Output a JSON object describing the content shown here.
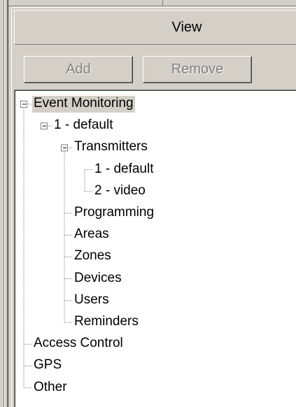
{
  "header": {
    "title": "View"
  },
  "toolbar": {
    "add_label": "Add",
    "remove_label": "Remove"
  },
  "tree": {
    "items": [
      {
        "label": "Event Monitoring",
        "level": 0,
        "expanded": true,
        "selected": true
      },
      {
        "label": "1 - default",
        "level": 1,
        "expanded": true
      },
      {
        "label": "Transmitters",
        "level": 2,
        "expanded": true
      },
      {
        "label": "1 - default",
        "level": 3
      },
      {
        "label": "2 - video",
        "level": 3
      },
      {
        "label": "Programming",
        "level": 2
      },
      {
        "label": "Areas",
        "level": 2
      },
      {
        "label": "Zones",
        "level": 2
      },
      {
        "label": "Devices",
        "level": 2
      },
      {
        "label": "Users",
        "level": 2
      },
      {
        "label": "Reminders",
        "level": 2
      },
      {
        "label": "Access Control",
        "level": 0
      },
      {
        "label": "GPS",
        "level": 0
      },
      {
        "label": "Other",
        "level": 0
      }
    ]
  }
}
